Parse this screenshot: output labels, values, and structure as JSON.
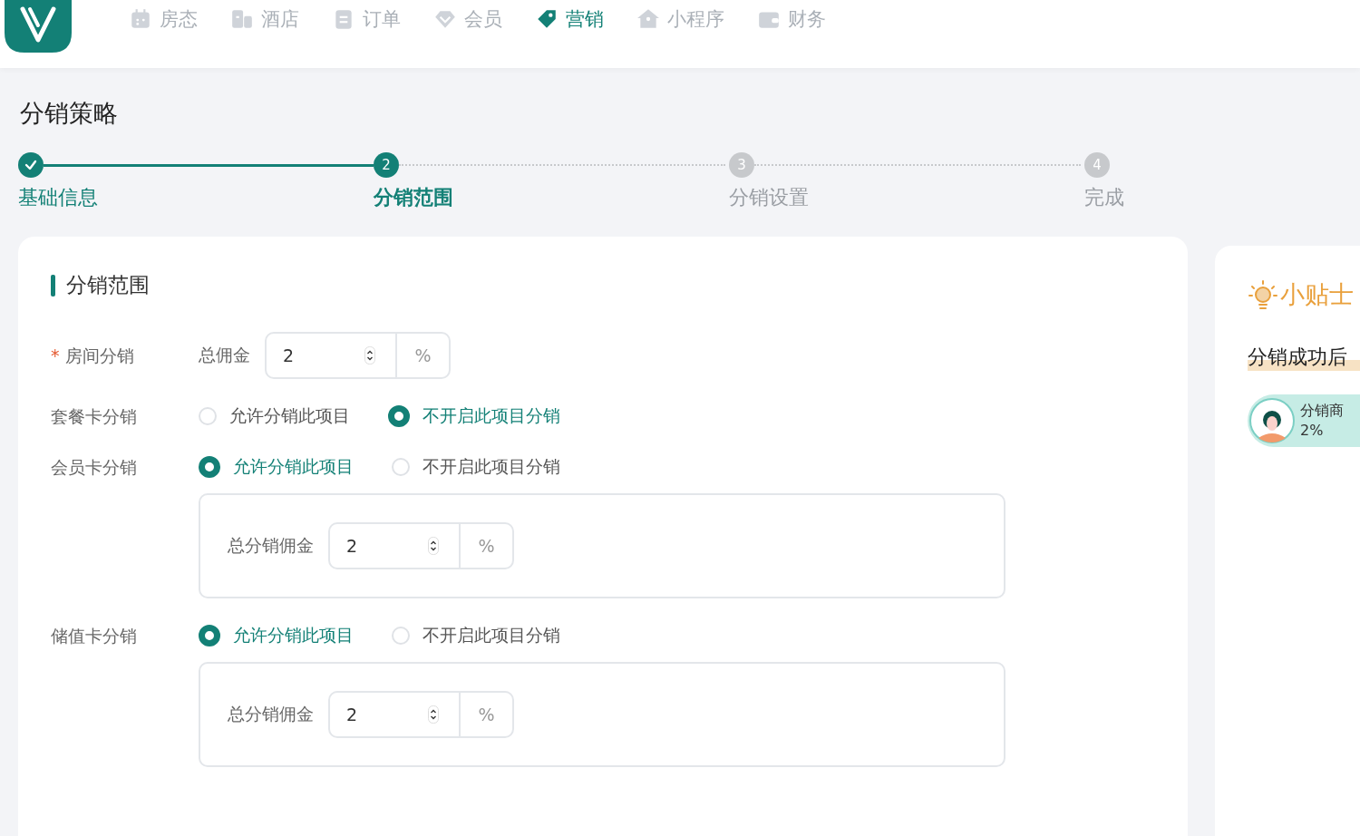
{
  "nav": [
    {
      "label": "房态",
      "selected": false
    },
    {
      "label": "酒店",
      "selected": false
    },
    {
      "label": "订单",
      "selected": false
    },
    {
      "label": "会员",
      "selected": false
    },
    {
      "label": "营销",
      "selected": true
    },
    {
      "label": "小程序",
      "selected": false
    },
    {
      "label": "财务",
      "selected": false
    }
  ],
  "page_title": "分销策略",
  "steps": [
    {
      "label": "基础信息",
      "completed": true,
      "selected": false
    },
    {
      "number": "2",
      "label": "分销范围",
      "completed": false,
      "selected": true
    },
    {
      "number": "3",
      "label": "分销设置",
      "completed": false,
      "selected": false
    },
    {
      "number": "4",
      "label": "完成",
      "completed": false,
      "selected": false
    }
  ],
  "form": {
    "title": "分销范围",
    "rows": [
      {
        "kind": "input",
        "required_mark": "*",
        "label": "房间分销",
        "prefix": "总佣金",
        "value": "2",
        "unit": "%"
      },
      {
        "kind": "radio",
        "label": "套餐卡分销",
        "options": [
          {
            "label": "允许分销此项目",
            "selected": false
          },
          {
            "label": "不开启此项目分销",
            "selected": true
          }
        ]
      },
      {
        "kind": "radio",
        "label": "会员卡分销",
        "options": [
          {
            "label": "允许分销此项目",
            "selected": true
          },
          {
            "label": "不开启此项目分销",
            "selected": false
          }
        ],
        "sub": {
          "label": "总分销佣金",
          "value": "2",
          "unit": "%"
        }
      },
      {
        "kind": "radio",
        "label": "储值卡分销",
        "options": [
          {
            "label": "允许分销此项目",
            "selected": true
          },
          {
            "label": "不开启此项目分销",
            "selected": false
          }
        ],
        "sub": {
          "label": "总分销佣金",
          "value": "2",
          "unit": "%"
        }
      }
    ]
  },
  "tips": {
    "title": "小贴士",
    "heading": "分销成功后",
    "role": "分销商",
    "rate": "2%"
  }
}
